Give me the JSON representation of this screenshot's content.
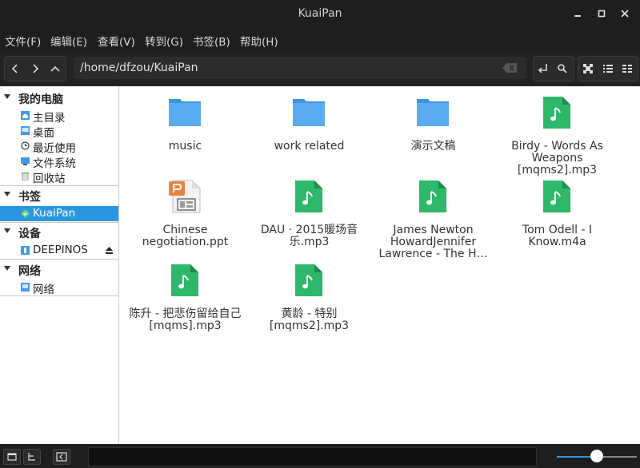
{
  "window": {
    "title": "KuaiPan",
    "min": "▬",
    "max": "□",
    "close": "✕"
  },
  "menu": [
    "文件(F)",
    "编辑(E)",
    "查看(V)",
    "转到(G)",
    "书签(B)",
    "帮助(H)"
  ],
  "path": {
    "value": "/home/dfzou/KuaiPan"
  },
  "sidebar": {
    "sections": [
      {
        "label": "我的电脑",
        "items": [
          "主目录",
          "桌面",
          "最近使用",
          "文件系统",
          "回收站"
        ]
      },
      {
        "label": "书签",
        "items": [
          "KuaiPan"
        ]
      },
      {
        "label": "设备",
        "items": [
          "DEEPINOS"
        ]
      },
      {
        "label": "网络",
        "items": [
          "网络"
        ]
      }
    ]
  },
  "files": [
    {
      "name": "music",
      "type": "folder"
    },
    {
      "name": "work related",
      "type": "folder"
    },
    {
      "name": "演示文稿",
      "type": "folder"
    },
    {
      "name": "Birdy - Words As Weapons [mqms2].mp3",
      "type": "audio"
    },
    {
      "name": "Chinese negotiation.ppt",
      "type": "ppt"
    },
    {
      "name": "DAU · 2015暖场音乐.mp3",
      "type": "audio"
    },
    {
      "name": "James Newton HowardJennifer Lawrence - The H…",
      "type": "audio"
    },
    {
      "name": "Tom Odell - I Know.m4a",
      "type": "audio"
    },
    {
      "name": "陈升 - 把悲伤留给自己 [mqms].mp3",
      "type": "audio"
    },
    {
      "name": "黄龄 - 特别 [mqms2].mp3",
      "type": "audio"
    }
  ],
  "colors": {
    "folder": "#5aabf0",
    "audio": "#2eb86a",
    "selection": "#2b96e0"
  },
  "zoom": {
    "value": 0.5
  }
}
